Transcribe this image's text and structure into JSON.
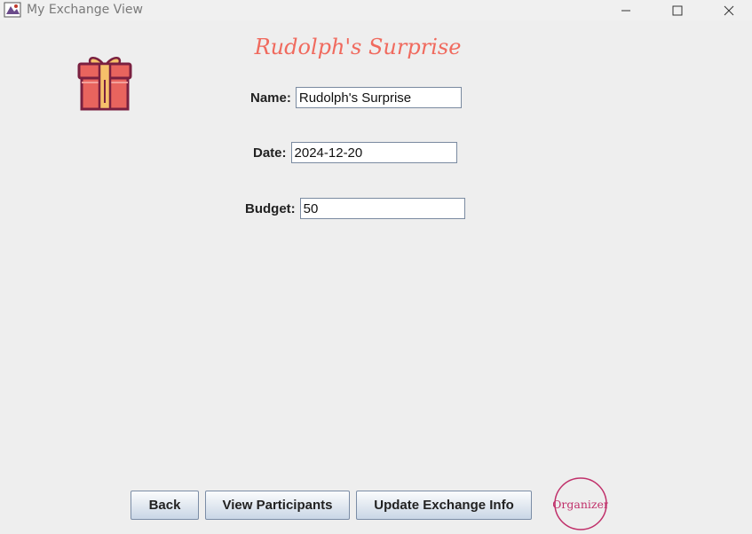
{
  "window": {
    "title": "My Exchange View",
    "controls": [
      "minimize-icon",
      "maximize-icon",
      "close-icon"
    ]
  },
  "header": {
    "title": "Rudolph's Surprise",
    "title_color": "#f06a5e",
    "icon": "gift-icon"
  },
  "form": {
    "name_label": "Name:",
    "name_value": "Rudolph's Surprise",
    "date_label": "Date:",
    "date_value": "2024-12-20",
    "budget_label": "Budget:",
    "budget_value": "50"
  },
  "buttons": {
    "back": "Back",
    "view_participants": "View Participants",
    "update_exchange_info": "Update Exchange Info"
  },
  "badge": {
    "label": "Organizer",
    "color": "#c0306a"
  }
}
